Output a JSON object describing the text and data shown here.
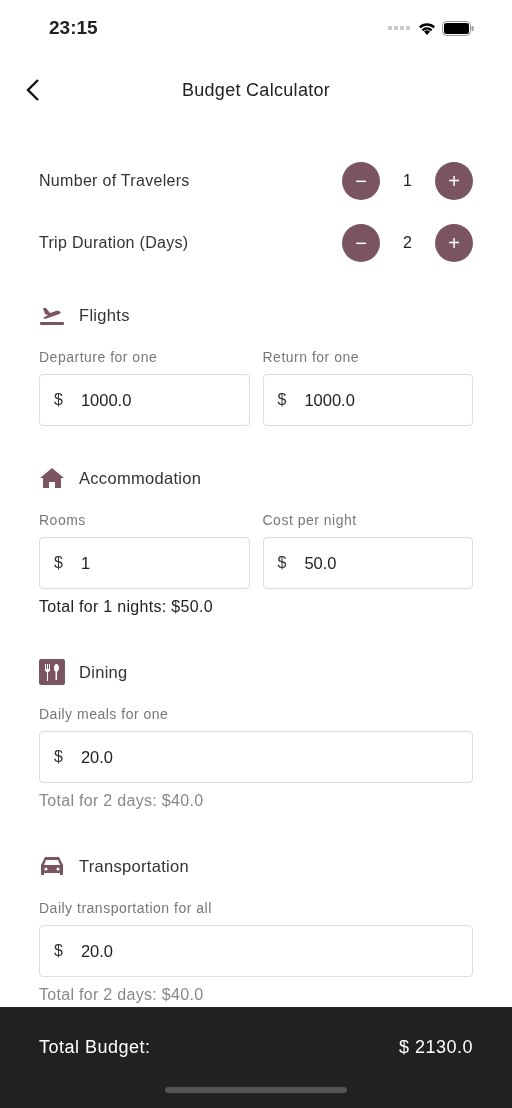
{
  "status_bar": {
    "time": "23:15"
  },
  "header": {
    "title": "Budget Calculator"
  },
  "steppers": [
    {
      "label": "Number of Travelers",
      "minus": "−",
      "value": "1",
      "plus": "+"
    },
    {
      "label": "Trip Duration (Days)",
      "minus": "−",
      "value": "2",
      "plus": "+"
    }
  ],
  "sections": [
    {
      "kind": "flights",
      "title": "Flights",
      "fields": [
        {
          "label": "Departure for one",
          "prefix": "$",
          "value": "1000.0"
        },
        {
          "label": "Return for one",
          "prefix": "$",
          "value": "1000.0"
        }
      ]
    },
    {
      "kind": "accommodation",
      "title": "Accommodation",
      "fields": [
        {
          "label": "Rooms",
          "prefix": "$",
          "value": "1"
        },
        {
          "label": "Cost per night",
          "prefix": "$",
          "value": "50.0"
        }
      ],
      "total": {
        "text": "Total for 1 nights: $50.0",
        "muted": false
      }
    },
    {
      "kind": "dining",
      "title": "Dining",
      "fields": [
        {
          "label": "Daily meals for one",
          "prefix": "$",
          "value": "20.0"
        }
      ],
      "total": {
        "text": "Total for 2 days: $40.0",
        "muted": true
      }
    },
    {
      "kind": "transportation",
      "title": "Transportation",
      "fields": [
        {
          "label": "Daily transportation for all",
          "prefix": "$",
          "value": "20.0"
        }
      ],
      "total": {
        "text": "Total for 2 days: $40.0",
        "muted": true
      }
    }
  ],
  "footer": {
    "label": "Total Budget:",
    "value": "$ 2130.0"
  }
}
